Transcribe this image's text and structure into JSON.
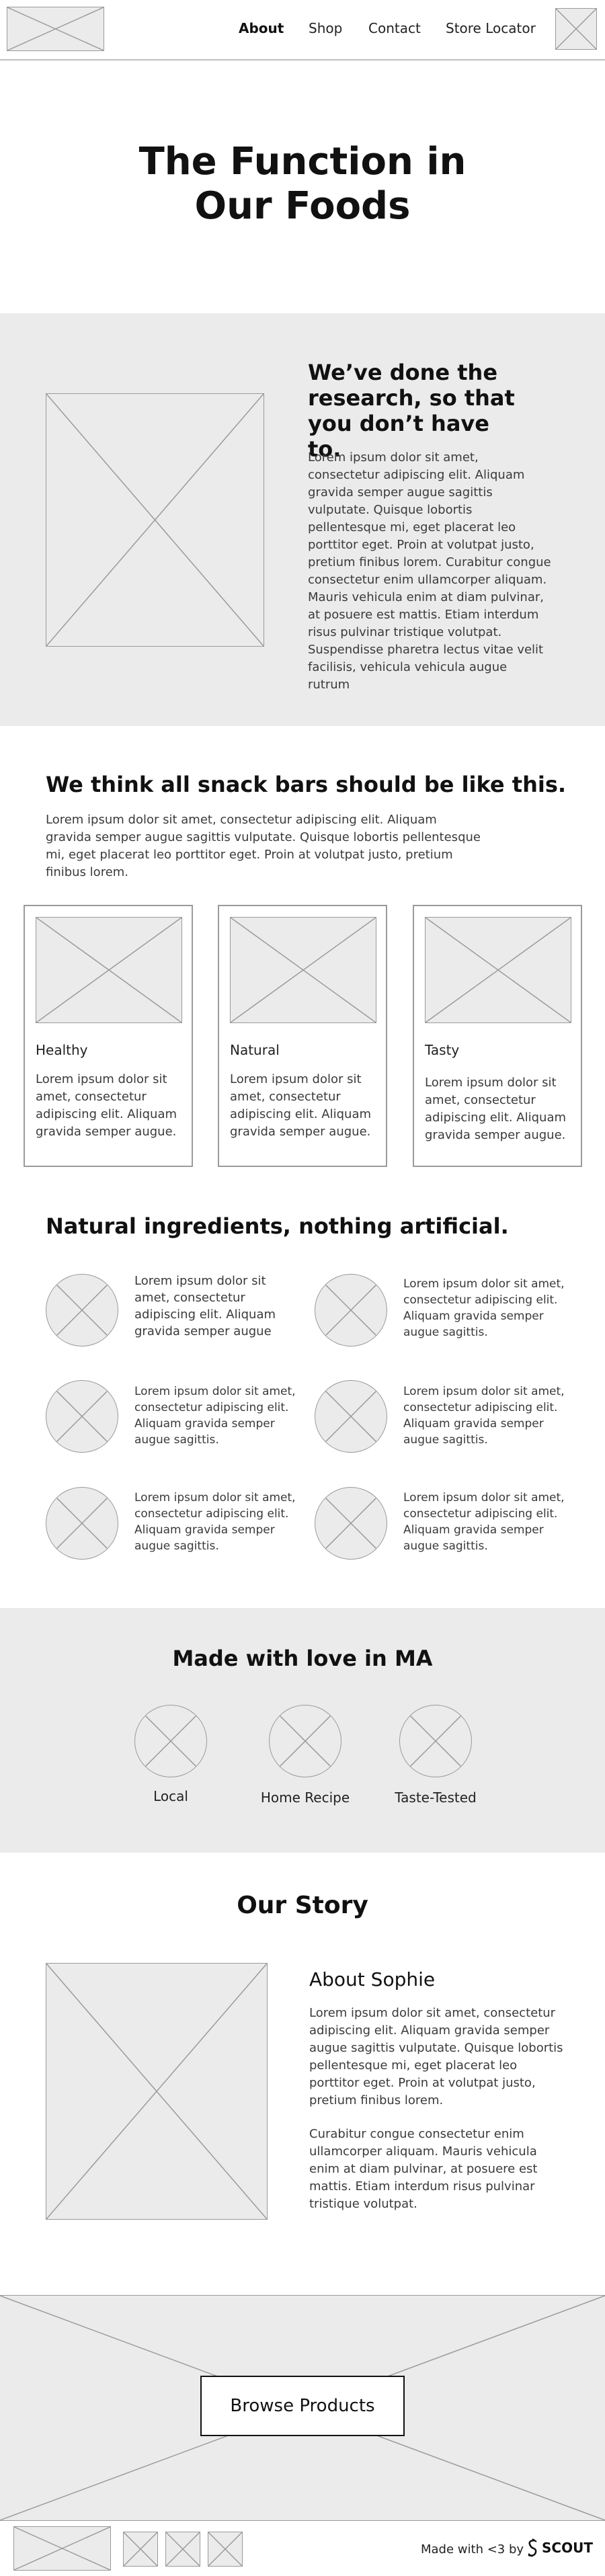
{
  "header": {
    "nav": [
      "About",
      "Shop",
      "Contact",
      "Store Locator"
    ],
    "active": "About"
  },
  "hero": {
    "title_line1": "The Function in",
    "title_line2": "Our Foods"
  },
  "research": {
    "heading_line1": "We’ve done the",
    "heading_line2": "research, so that",
    "heading_line3": "you don’t have to.",
    "p1": "Lorem ipsum dolor sit amet, consectetur adipiscing elit. Aliquam gravida semper augue sagittis vulputate. Quisque lobortis pellentesque mi, eget placerat leo porttitor eget. Proin at volutpat justo, pretium finibus lorem. Curabitur congue consectetur enim ullamcorper aliquam.",
    "p2": "Mauris vehicula enim at diam pulvinar, at posuere est mattis. Etiam interdum risus pulvinar tristique volutpat. Suspendisse pharetra lectus vitae velit facilisis, vehicula vehicula augue rutrum"
  },
  "snack": {
    "heading": "We think all snack bars should be like this.",
    "text": "Lorem ipsum dolor sit amet, consectetur adipiscing elit. Aliquam gravida semper augue sagittis vulputate. Quisque lobortis pellentesque mi, eget placerat leo porttitor eget. Proin at volutpat justo, pretium finibus lorem.",
    "cards": [
      {
        "title": "Healthy",
        "text": "Lorem ipsum dolor sit amet, consectetur adipiscing elit. Aliquam gravida semper augue."
      },
      {
        "title": "Natural",
        "text": "Lorem ipsum dolor sit amet, consectetur adipiscing elit. Aliquam gravida semper augue."
      },
      {
        "title": "Tasty",
        "text": "Lorem ipsum dolor sit amet, consectetur adipiscing elit. Aliquam gravida semper augue."
      }
    ]
  },
  "ingredients": {
    "heading": "Natural ingredients, nothing artificial.",
    "items": [
      "Lorem ipsum dolor sit amet, consectetur adipiscing elit. Aliquam gravida semper augue",
      "Lorem ipsum dolor sit amet, consectetur adipiscing elit. Aliquam gravida semper augue sagittis.",
      "Lorem ipsum dolor sit amet, consectetur adipiscing elit. Aliquam gravida semper augue sagittis.",
      "Lorem ipsum dolor sit amet, consectetur adipiscing elit. Aliquam gravida semper augue sagittis.",
      "Lorem ipsum dolor sit amet, consectetur adipiscing elit. Aliquam gravida semper augue sagittis.",
      "Lorem ipsum dolor sit amet, consectetur adipiscing elit. Aliquam gravida semper augue sagittis."
    ]
  },
  "love": {
    "heading": "Made with love in MA",
    "items": [
      "Local",
      "Home Recipe",
      "Taste-Tested"
    ]
  },
  "story": {
    "heading": "Our Story",
    "subheading": "About Sophie",
    "p1": "Lorem ipsum dolor sit amet, consectetur adipiscing elit. Aliquam gravida semper augue sagittis vulputate. Quisque lobortis pellentesque mi, eget placerat leo porttitor eget. Proin at volutpat justo, pretium finibus lorem.",
    "p2": "Curabitur congue consectetur enim ullamcorper aliquam. Mauris vehicula enim at diam pulvinar, at posuere est mattis. Etiam interdum risus pulvinar tristique volutpat."
  },
  "cta": {
    "button": "Browse Products"
  },
  "footer": {
    "made_with": "Made with <3 by",
    "brand": "SCOUT"
  }
}
